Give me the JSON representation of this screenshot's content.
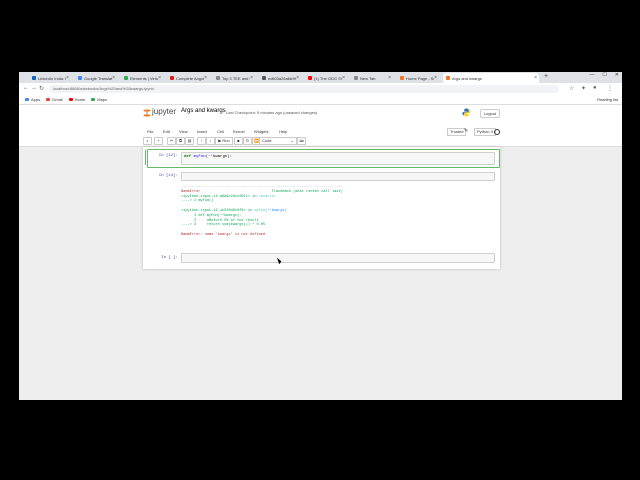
{
  "tabs": [
    {
      "label": "LinkedIn India: Log",
      "color": "#0a66c2"
    },
    {
      "label": "Google Translate",
      "color": "#4285f4"
    },
    {
      "label": "Elements | Virtuoso",
      "color": "#34a853"
    },
    {
      "label": "Complete Angular",
      "color": "#dd1b16"
    },
    {
      "label": "Top 3 TEE and NTI",
      "color": "#888888"
    },
    {
      "label": "edit03a26a6b9f07",
      "color": "#555555"
    },
    {
      "label": "(1) The GDG Show",
      "color": "#ff0000"
    },
    {
      "label": "New Tab",
      "color": "#888888"
    },
    {
      "label": "Home Page - Select",
      "color": "#f37626"
    },
    {
      "label": "Args and kwargs",
      "color": "#f37626",
      "active": true
    }
  ],
  "url": "localhost:8888/notebooks/Args%20and%20kwargs.ipynb",
  "bookmarks": [
    {
      "label": "Apps",
      "color": "#4285f4"
    },
    {
      "label": "Gmail",
      "color": "#ea4335"
    },
    {
      "label": "Home",
      "color": "#ff0000"
    },
    {
      "label": "Maps",
      "color": "#34a853"
    }
  ],
  "reading_list": "Reading list",
  "jupyter": {
    "brand": "jupyter",
    "notebook_name": "Args and kwargs",
    "checkpoint": "Last Checkpoint: 5 minutes ago  (unsaved changes)",
    "logout": "Logout",
    "trusted": "Trusted",
    "kernel": "Python 3"
  },
  "menus": [
    "File",
    "Edit",
    "View",
    "Insert",
    "Cell",
    "Kernel",
    "Widgets",
    "Help"
  ],
  "toolbar": {
    "run": "Run",
    "cell_type": "Code"
  },
  "cells": [
    {
      "prompt": "In [12]:",
      "code": "def myFun(**kwargs):"
    },
    {
      "prompt": "In [14]:",
      "code": ""
    },
    {
      "prompt": "In [ ]:",
      "code": ""
    }
  ],
  "output": {
    "line1a": "NameError",
    "line1b": "                                 Traceback (most recent call last)",
    "line2a": "<ipython-input-14-a6a9c2dcc0611> in ",
    "line2b": "<module>",
    "line3": "----> 1 myFun()",
    "line4a": "<ipython-input-12-1c526d9c0f9> in ",
    "line4b": "myFun",
    "line4c": "(**kwargs)",
    "line5": "      1 def myFun(**kwargs):",
    "line6": "      2     #Return 5% of the result",
    "line7": "----> 3     return sum(kwargs()) * 0.05",
    "error": "NameError: name 'kwargs' is not defined"
  }
}
